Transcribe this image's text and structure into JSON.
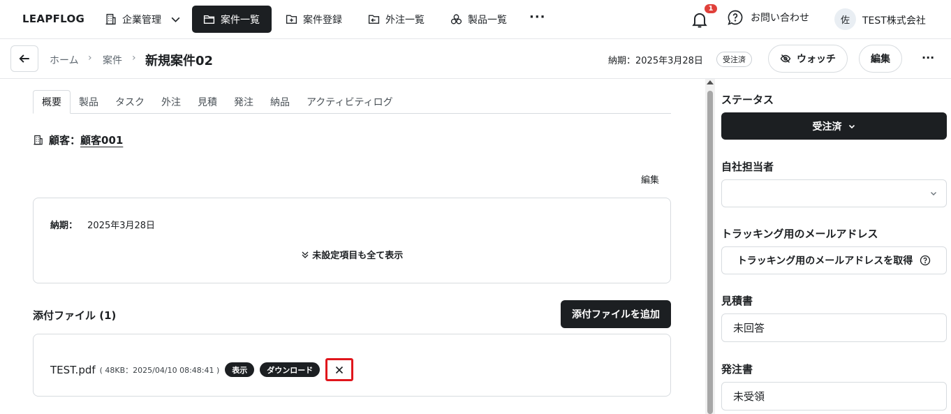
{
  "nav": {
    "logo": "LEAPFLOG",
    "company_mgmt": "企業管理",
    "items": [
      {
        "label": "案件一覧",
        "icon": "folder-icon"
      },
      {
        "label": "案件登録",
        "icon": "folder-plus-icon"
      },
      {
        "label": "外注一覧",
        "icon": "folder-arrow-icon"
      },
      {
        "label": "製品一覧",
        "icon": "cubes-icon"
      }
    ],
    "more": "···",
    "notification_count": "1",
    "contact": "お問い合わせ",
    "avatar": "佐",
    "company": "TEST株式会社"
  },
  "subheader": {
    "breadcrumb": [
      "ホーム",
      "案件"
    ],
    "separator": "›",
    "title": "新規案件02",
    "due": "納期：2025年3月28日",
    "status_badge": "受注済",
    "watch": "ウォッチ",
    "edit": "編集",
    "more": "···"
  },
  "tabs": [
    "概要",
    "製品",
    "タスク",
    "外注",
    "見積",
    "発注",
    "納品",
    "アクティビティログ"
  ],
  "overview": {
    "customer_label": "顧客：",
    "customer_name": "顧客001",
    "edit": "編集",
    "due_label": "納期：",
    "due_value": "2025年3月28日",
    "show_all": "未設定項目も全て表示"
  },
  "attachments": {
    "title": "添付ファイル (1)",
    "add_button": "添付ファイルを追加",
    "files": [
      {
        "name": "TEST.pdf",
        "meta": "( 48KB：2025/04/10 08:48:41 )",
        "view": "表示",
        "download": "ダウンロード"
      }
    ]
  },
  "sidebar": {
    "status_label": "ステータス",
    "status_value": "受注済",
    "owner_label": "自社担当者",
    "owner_value": "",
    "tracking_label": "トラッキング用のメールアドレス",
    "tracking_button": "トラッキング用のメールアドレスを取得",
    "quote_label": "見積書",
    "quote_value": "未回答",
    "order_label": "発注書",
    "order_value": "未受領"
  },
  "colors": {
    "primary": "#1c1f22",
    "badge_red": "#e0403a",
    "highlight": "#e0161c"
  }
}
